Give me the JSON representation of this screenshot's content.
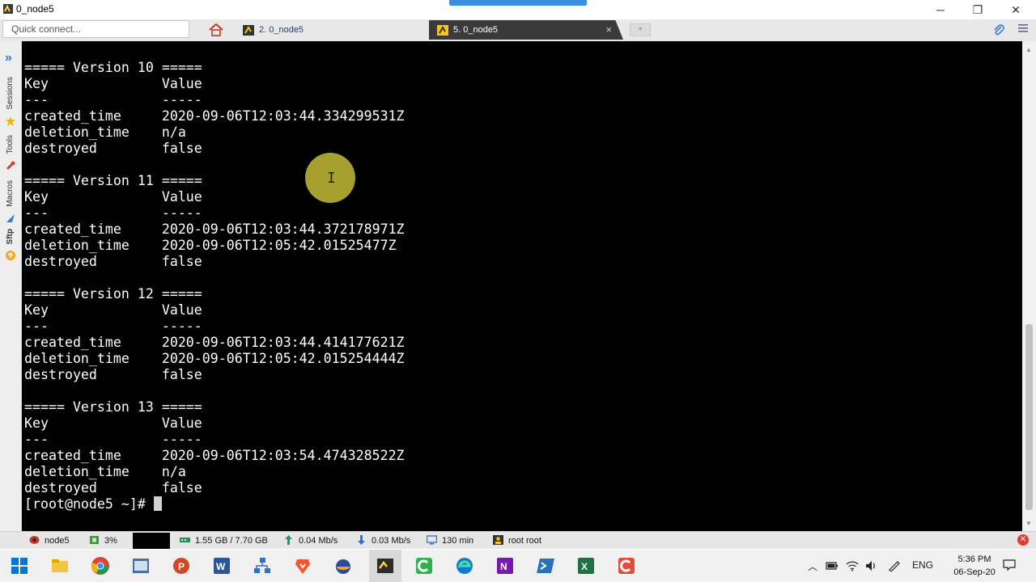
{
  "window": {
    "title": "0_node5",
    "minimize": "─",
    "restore": "❐",
    "close": "✕"
  },
  "toolbar": {
    "quick_connect_placeholder": "Quick connect...",
    "tabs": [
      {
        "label": "2. 0_node5",
        "active": false
      },
      {
        "label": "5. 0_node5",
        "active": true
      }
    ],
    "close_tab": "×",
    "new_tab": "+",
    "attach_icon": "paperclip-icon",
    "menu_icon": "hamburger-icon"
  },
  "sidebar": {
    "expand": "»",
    "labels": [
      "Sessions",
      "Tools",
      "Macros",
      "Sftp"
    ]
  },
  "terminal": {
    "lines": [
      "===== Version 10 =====",
      "Key              Value",
      "---              -----",
      "created_time     2020-09-06T12:03:44.334299531Z",
      "deletion_time    n/a",
      "destroyed        false",
      "",
      "===== Version 11 =====",
      "Key              Value",
      "---              -----",
      "created_time     2020-09-06T12:03:44.372178971Z",
      "deletion_time    2020-09-06T12:05:42.01525477Z",
      "destroyed        false",
      "",
      "===== Version 12 =====",
      "Key              Value",
      "---              -----",
      "created_time     2020-09-06T12:03:44.414177621Z",
      "deletion_time    2020-09-06T12:05:42.015254444Z",
      "destroyed        false",
      "",
      "===== Version 13 =====",
      "Key              Value",
      "---              -----",
      "created_time     2020-09-06T12:03:54.474328522Z",
      "deletion_time    n/a",
      "destroyed        false"
    ],
    "prompt": "[root@node5 ~]# "
  },
  "statusbar": {
    "host": "node5",
    "cpu": "3%",
    "memory": "1.55 GB / 7.70 GB",
    "upload": "0.04 Mb/s",
    "download": "0.03 Mb/s",
    "uptime": "130 min",
    "user": "root  root"
  },
  "taskbar": {
    "icons": [
      "windows-start-icon",
      "file-explorer-icon",
      "chrome-icon",
      "mobaxterm-icon",
      "powerpoint-icon",
      "word-icon",
      "network-icon",
      "brave-icon",
      "vpn-icon",
      "terminal-icon",
      "camtasia-icon",
      "edge-icon",
      "onenote-icon",
      "powershell-icon",
      "excel-icon",
      "recorder-icon"
    ],
    "lang": "ENG",
    "time": "5:36 PM",
    "date": "06-Sep-20"
  }
}
